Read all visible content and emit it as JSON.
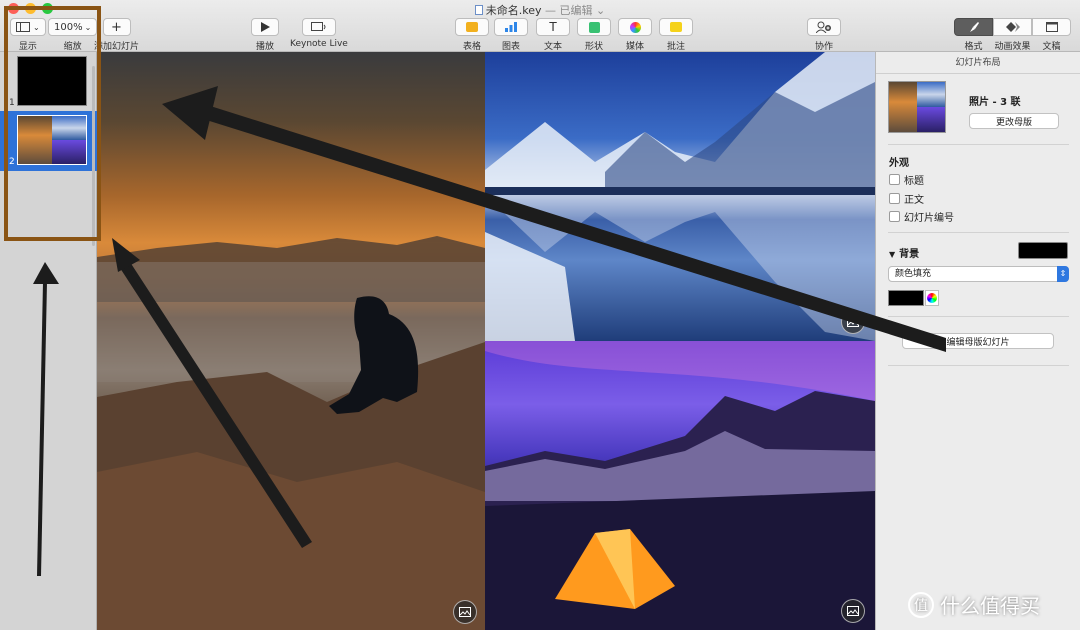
{
  "window": {
    "title": "未命名.key",
    "subtitle": "— 已编辑",
    "traffic_colors": [
      "#fd5f57",
      "#febc2e",
      "#28c840"
    ]
  },
  "toolbar": {
    "view_label": "显示",
    "zoom_value": "100%",
    "zoom_label": "缩放",
    "add_slide_label": "添加幻灯片",
    "play_label": "播放",
    "keynote_live_label": "Keynote Live",
    "table_label": "表格",
    "chart_label": "图表",
    "text_label": "文本",
    "shape_label": "形状",
    "media_label": "媒体",
    "comment_label": "批注",
    "collaborate_label": "协作",
    "format_label": "格式",
    "animate_label": "动画效果",
    "document_label": "文稿"
  },
  "navigator": {
    "slides": [
      {
        "number": "1"
      },
      {
        "number": "2"
      }
    ]
  },
  "inspector": {
    "header": "幻灯片布局",
    "layout_name": "照片 - 3 联",
    "change_master_label": "更改母版",
    "appearance_title": "外观",
    "appearance_options": [
      {
        "label": "标题",
        "checked": false
      },
      {
        "label": "正文",
        "checked": false
      },
      {
        "label": "幻灯片编号",
        "checked": false
      }
    ],
    "background_title": "背景",
    "background_color": "#000000",
    "fill_type": "颜色填充",
    "edit_master_label": "编辑母版幻灯片"
  },
  "annotations": {
    "highlight_color": "#8a5414",
    "arrow_color": "#1c1c1c"
  },
  "watermark": {
    "logo_char": "值",
    "text": "什么值得买"
  }
}
